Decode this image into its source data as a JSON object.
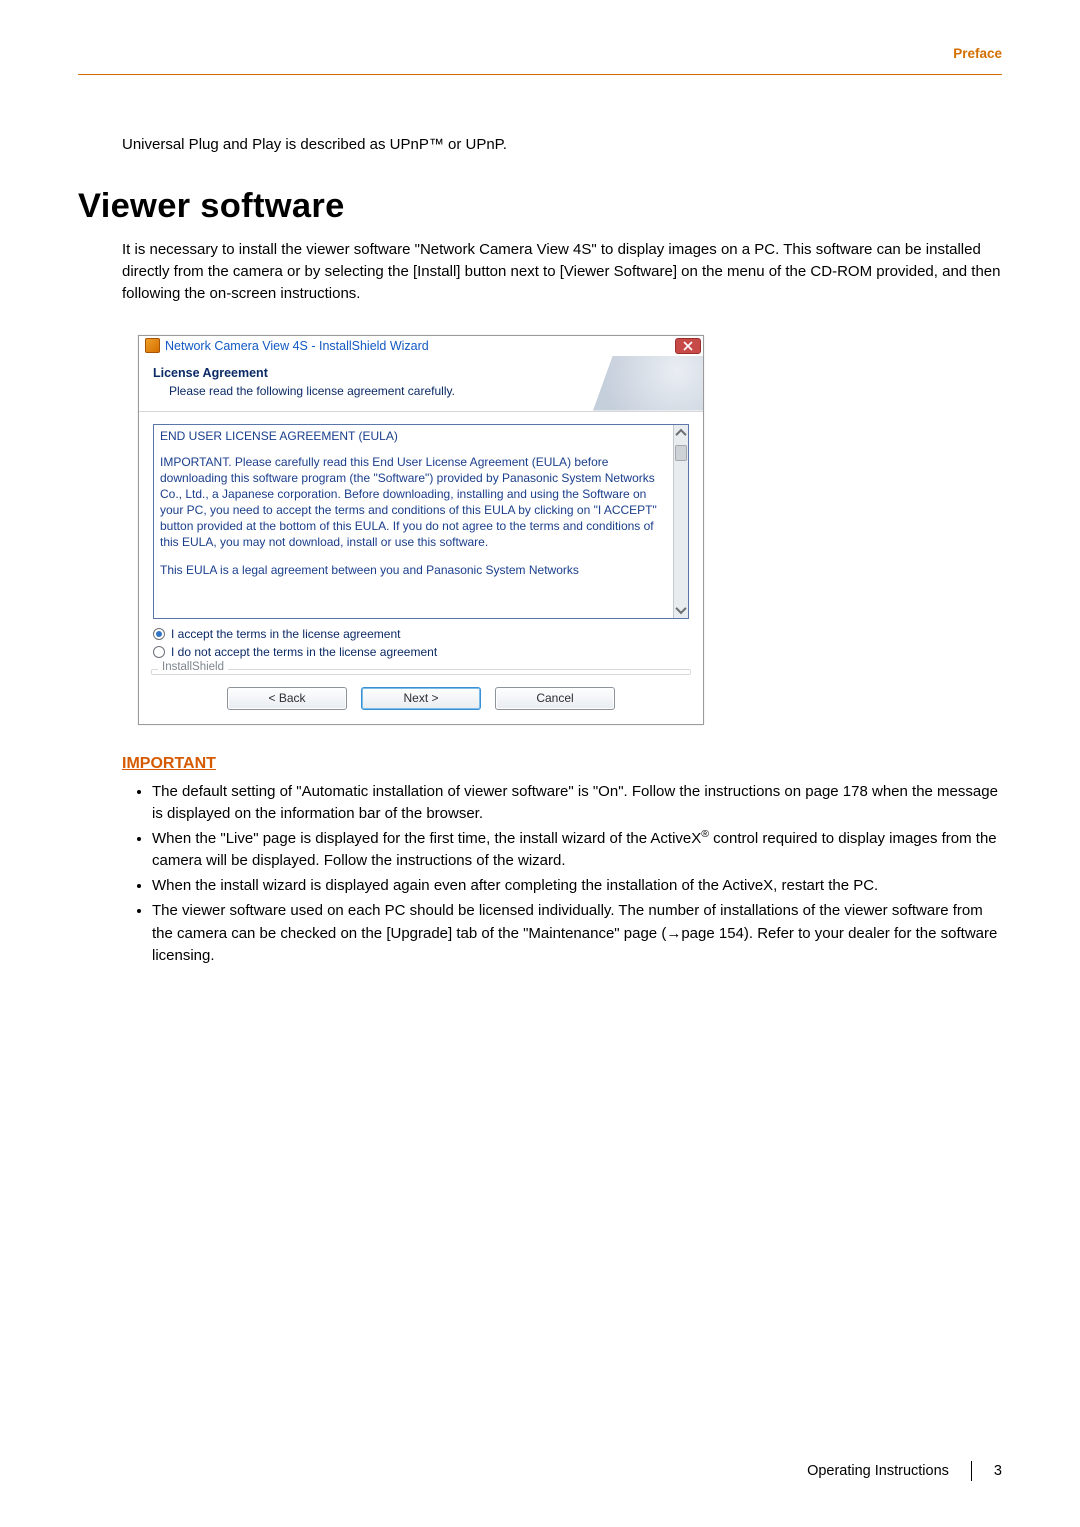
{
  "header": {
    "preface": "Preface"
  },
  "intro": {
    "line": "Universal Plug and Play is described as UPnP™ or UPnP."
  },
  "h1": "Viewer software",
  "lead": "It is necessary to install the viewer software \"Network Camera View 4S\" to display images on a PC. This software can be installed directly from the camera or by selecting the [Install] button next to [Viewer Software] on the menu of the CD-ROM provided, and then following the on-screen instructions.",
  "dialog": {
    "window_title": "Network Camera View 4S - InstallShield Wizard",
    "head_title": "License Agreement",
    "head_sub": "Please read the following license agreement carefully.",
    "eula_title": "END USER LICENSE AGREEMENT (EULA)",
    "eula_para1": "IMPORTANT.  Please carefully read this End User License Agreement (EULA) before downloading this software program (the \"Software\") provided by Panasonic System Networks Co., Ltd., a Japanese corporation.  Before downloading, installing and using the Software on your PC, you need to accept the terms and conditions of this EULA by clicking on \"I ACCEPT\" button provided at the bottom of this EULA.  If you do not agree to the terms and conditions of this EULA, you may not download, install or use this software.",
    "eula_para2": "This EULA is a legal agreement between you and Panasonic System Networks",
    "radio_accept": "I accept the terms in the license agreement",
    "radio_reject": "I do not accept the terms in the license agreement",
    "legend": "InstallShield",
    "back": "< Back",
    "next": "Next >",
    "cancel": "Cancel"
  },
  "important_label": "IMPORTANT",
  "bullets": {
    "b1a": "The default setting of \"Automatic installation of viewer software\" is \"On\". Follow the instructions on page 178 when the message is displayed on the information bar of the browser.",
    "b2a": "When the \"Live\" page is displayed for the first time, the install wizard of the ActiveX",
    "b2b": " control required to display images from the camera will be displayed. Follow the instructions of the wizard.",
    "b3": "When the install wizard is displayed again even after completing the installation of the ActiveX, restart the PC.",
    "b4a": "The viewer software used on each PC should be licensed individually. The number of installations of the viewer software from the camera can be checked on the [Upgrade] tab of the \"Maintenance\" page (",
    "b4arrow": "→",
    "b4b": "page 154). Refer to your dealer for the software licensing."
  },
  "sup": "®",
  "footer": {
    "label": "Operating Instructions",
    "page": "3"
  }
}
